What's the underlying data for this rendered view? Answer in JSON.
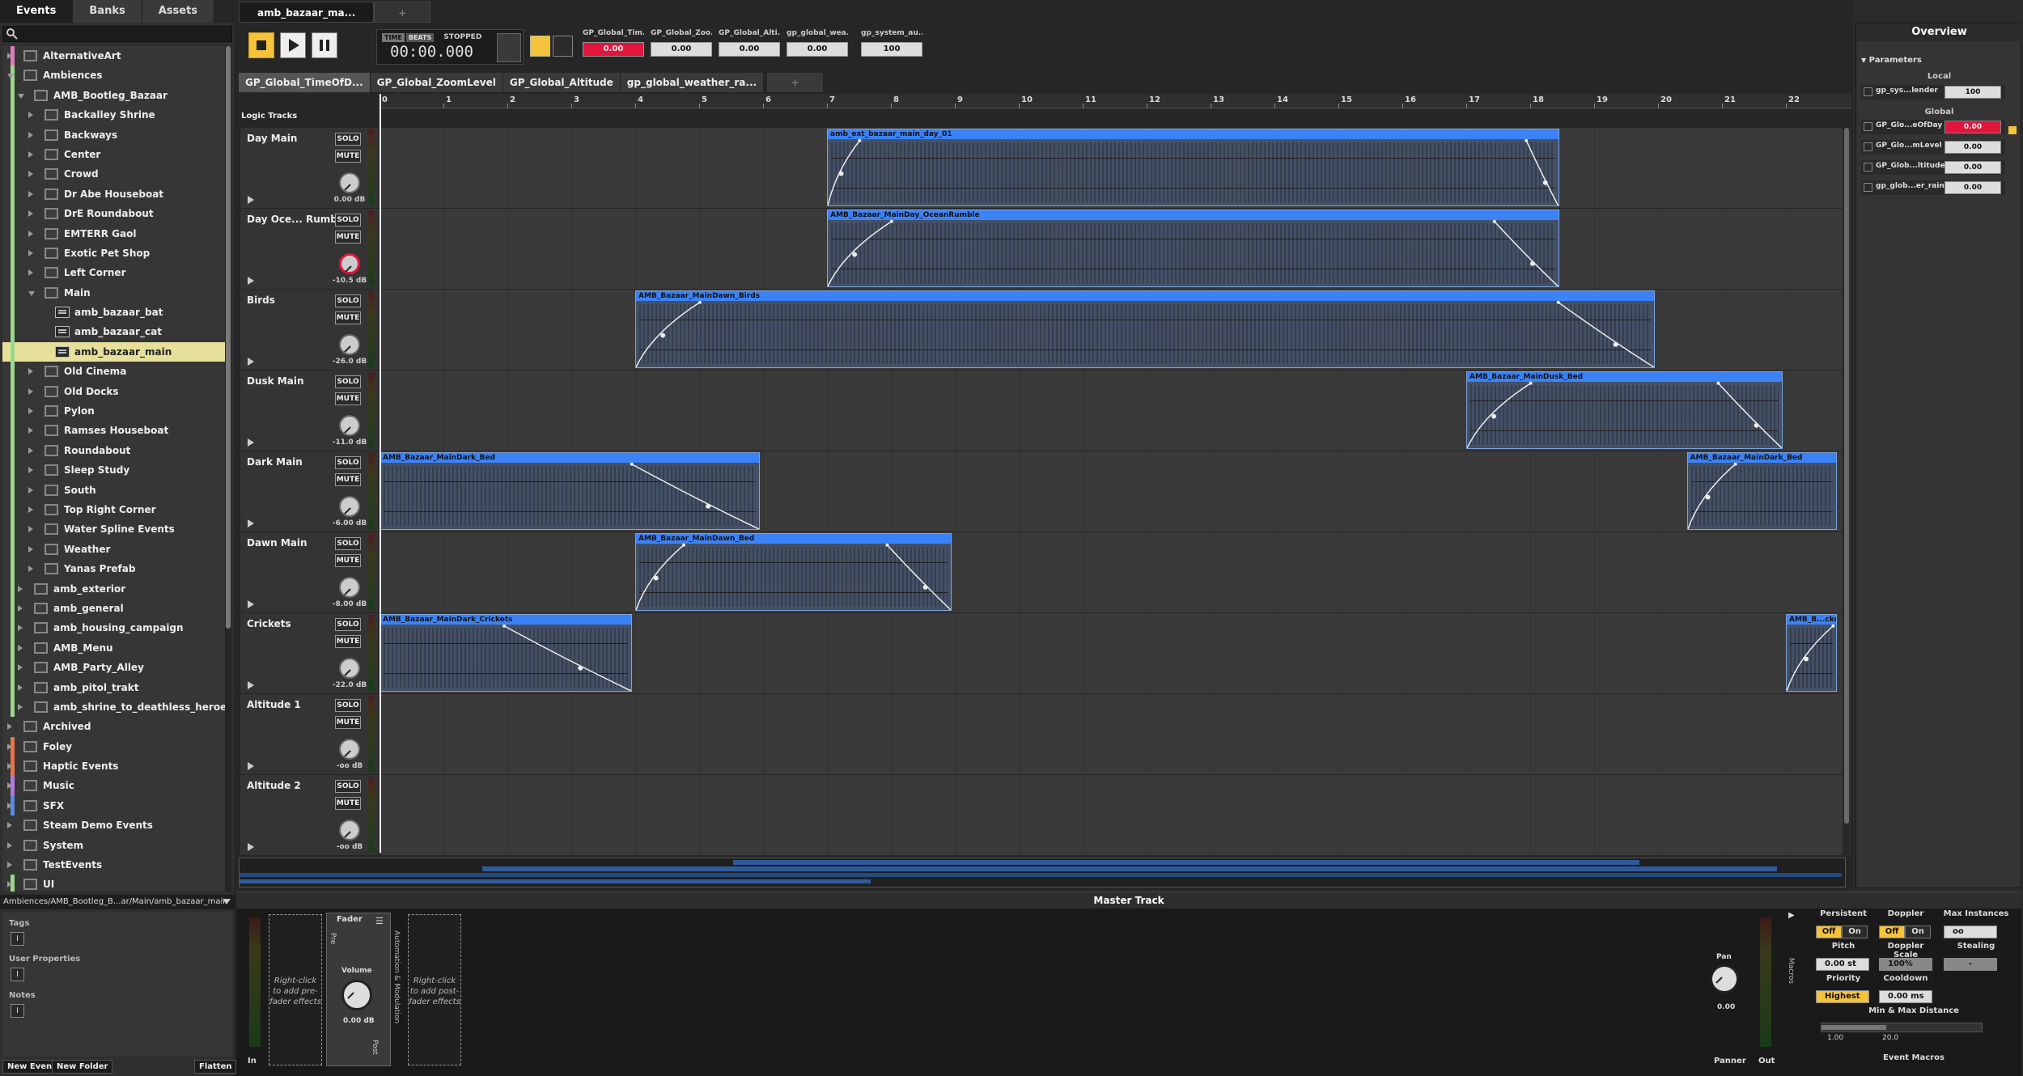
{
  "browser": {
    "tabs": [
      "Events",
      "Banks",
      "Assets"
    ],
    "tree": [
      {
        "label": "AlternativeArt",
        "indent": 0,
        "type": "folder",
        "open": false,
        "color": "#e07ab8"
      },
      {
        "label": "Ambiences",
        "indent": 0,
        "type": "folder",
        "open": true,
        "color": "#9ad88a"
      },
      {
        "label": "AMB_Bootleg_Bazaar",
        "indent": 1,
        "type": "folder",
        "open": true,
        "color": "#9ad88a"
      },
      {
        "label": "Backalley Shrine",
        "indent": 2,
        "type": "folder",
        "open": false,
        "color": "#9ad88a"
      },
      {
        "label": "Backways",
        "indent": 2,
        "type": "folder",
        "open": false,
        "color": "#9ad88a"
      },
      {
        "label": "Center",
        "indent": 2,
        "type": "folder",
        "open": false,
        "color": "#9ad88a"
      },
      {
        "label": "Crowd",
        "indent": 2,
        "type": "folder",
        "open": false,
        "color": "#9ad88a"
      },
      {
        "label": "Dr Abe Houseboat",
        "indent": 2,
        "type": "folder",
        "open": false,
        "color": "#9ad88a"
      },
      {
        "label": "DrE Roundabout",
        "indent": 2,
        "type": "folder",
        "open": false,
        "color": "#9ad88a"
      },
      {
        "label": "EMTERR Gaol",
        "indent": 2,
        "type": "folder",
        "open": false,
        "color": "#9ad88a"
      },
      {
        "label": "Exotic Pet Shop",
        "indent": 2,
        "type": "folder",
        "open": false,
        "color": "#9ad88a"
      },
      {
        "label": "Left Corner",
        "indent": 2,
        "type": "folder",
        "open": false,
        "color": "#9ad88a"
      },
      {
        "label": "Main",
        "indent": 2,
        "type": "folder",
        "open": true,
        "color": "#9ad88a"
      },
      {
        "label": "amb_bazaar_bat",
        "indent": 3,
        "type": "event",
        "color": "#9ad88a"
      },
      {
        "label": "amb_bazaar_cat",
        "indent": 3,
        "type": "event",
        "color": "#9ad88a"
      },
      {
        "label": "amb_bazaar_main",
        "indent": 3,
        "type": "event",
        "color": "#9ad88a",
        "selected": true
      },
      {
        "label": "Old Cinema",
        "indent": 2,
        "type": "folder",
        "open": false,
        "color": "#9ad88a"
      },
      {
        "label": "Old Docks",
        "indent": 2,
        "type": "folder",
        "open": false,
        "color": "#9ad88a"
      },
      {
        "label": "Pylon",
        "indent": 2,
        "type": "folder",
        "open": false,
        "color": "#9ad88a"
      },
      {
        "label": "Ramses Houseboat",
        "indent": 2,
        "type": "folder",
        "open": false,
        "color": "#9ad88a"
      },
      {
        "label": "Roundabout",
        "indent": 2,
        "type": "folder",
        "open": false,
        "color": "#9ad88a"
      },
      {
        "label": "Sleep Study",
        "indent": 2,
        "type": "folder",
        "open": false,
        "color": "#9ad88a"
      },
      {
        "label": "South",
        "indent": 2,
        "type": "folder",
        "open": false,
        "color": "#9ad88a"
      },
      {
        "label": "Top Right Corner",
        "indent": 2,
        "type": "folder",
        "open": false,
        "color": "#9ad88a"
      },
      {
        "label": "Water Spline Events",
        "indent": 2,
        "type": "folder",
        "open": false,
        "color": "#9ad88a"
      },
      {
        "label": "Weather",
        "indent": 2,
        "type": "folder",
        "open": false,
        "color": "#9ad88a"
      },
      {
        "label": "Yanas Prefab",
        "indent": 2,
        "type": "folder",
        "open": false,
        "color": "#9ad88a"
      },
      {
        "label": "amb_exterior",
        "indent": 1,
        "type": "folder",
        "open": false,
        "color": "#9ad88a"
      },
      {
        "label": "amb_general",
        "indent": 1,
        "type": "folder",
        "open": false,
        "color": "#9ad88a"
      },
      {
        "label": "amb_housing_campaign",
        "indent": 1,
        "type": "folder",
        "open": false,
        "color": "#9ad88a"
      },
      {
        "label": "AMB_Menu",
        "indent": 1,
        "type": "folder",
        "open": false,
        "color": "#9ad88a"
      },
      {
        "label": "AMB_Party_Alley",
        "indent": 1,
        "type": "folder",
        "open": false,
        "color": "#9ad88a"
      },
      {
        "label": "amb_pitol_trakt",
        "indent": 1,
        "type": "folder",
        "open": false,
        "color": "#9ad88a"
      },
      {
        "label": "amb_shrine_to_deathless_heroes",
        "indent": 1,
        "type": "folder",
        "open": false,
        "color": "#9ad88a"
      },
      {
        "label": "Archived",
        "indent": 0,
        "type": "folder",
        "open": false,
        "color": ""
      },
      {
        "label": "Foley",
        "indent": 0,
        "type": "folder",
        "open": false,
        "color": "#e8734a"
      },
      {
        "label": "Haptic Events",
        "indent": 0,
        "type": "folder",
        "open": false,
        "color": "#e8734a"
      },
      {
        "label": "Music",
        "indent": 0,
        "type": "folder",
        "open": false,
        "color": "#b07ad8"
      },
      {
        "label": "SFX",
        "indent": 0,
        "type": "folder",
        "open": false,
        "color": "#5a8ae0"
      },
      {
        "label": "Steam Demo Events",
        "indent": 0,
        "type": "folder",
        "open": false,
        "color": ""
      },
      {
        "label": "System",
        "indent": 0,
        "type": "folder",
        "open": false,
        "color": ""
      },
      {
        "label": "TestEvents",
        "indent": 0,
        "type": "folder",
        "open": false,
        "color": ""
      },
      {
        "label": "UI",
        "indent": 0,
        "type": "folder",
        "open": false,
        "color": "#9ad88a"
      }
    ],
    "path": "Ambiences/AMB_Bootleg_B...ar/Main/amb_bazaar_main",
    "props": {
      "tags": "Tags",
      "user_props": "User Properties",
      "notes": "Notes",
      "add_glyph": "I"
    },
    "buttons": {
      "new_event": "New Event",
      "new_folder": "New Folder",
      "flatten": "Flatten"
    }
  },
  "editor": {
    "tab": "amb_bazaar_ma...",
    "add_tab": "+",
    "time_mode": [
      "TIME",
      "BEATS"
    ],
    "state": "STOPPED",
    "time": "00:00.000",
    "params": [
      {
        "label": "GP_Global_Tim...",
        "value": "0.00",
        "red": true
      },
      {
        "label": "GP_Global_Zoo...",
        "value": "0.00",
        "red": false
      },
      {
        "label": "GP_Global_Alti...",
        "value": "0.00",
        "red": false
      },
      {
        "label": "gp_global_wea...",
        "value": "0.00",
        "red": false
      },
      {
        "label": "gp_system_au...",
        "value": "100",
        "red": false
      }
    ],
    "param_tabs": [
      "GP_Global_TimeOfD...",
      "GP_Global_ZoomLevel",
      "GP_Global_Altitude",
      "gp_global_weather_ra...",
      "+"
    ],
    "ruler": [
      "0",
      "1",
      "2",
      "3",
      "4",
      "5",
      "6",
      "7",
      "8",
      "9",
      "10",
      "11",
      "12",
      "13",
      "14",
      "15",
      "16",
      "17",
      "18",
      "19",
      "20",
      "21",
      "22"
    ],
    "logic_label": "Logic Tracks",
    "solo": "SOLO",
    "mute": "MUTE",
    "tracks": [
      {
        "name": "Day Main",
        "volume": "0.00 dB",
        "red_knob": false,
        "instruments": [
          {
            "title": "amb_ext_bazaar_main_day_01",
            "start": 7.0,
            "end": 18.45,
            "fade_in": 0.5,
            "fade_out": 0.5
          }
        ]
      },
      {
        "name": "Day Oce... Rumble",
        "volume": "-10.5 dB",
        "red_knob": true,
        "instruments": [
          {
            "title": "AMB_Bazaar_MainDay_OceanRumble",
            "start": 7.0,
            "end": 18.45,
            "fade_in": 1.0,
            "fade_out": 1.0
          }
        ]
      },
      {
        "name": "Birds",
        "volume": "-26.0 dB",
        "red_knob": false,
        "instruments": [
          {
            "title": "AMB_Bazaar_MainDawn_Birds",
            "start": 4.0,
            "end": 19.95,
            "fade_in": 1.0,
            "fade_out": 1.5
          }
        ]
      },
      {
        "name": "Dusk Main",
        "volume": "-11.0 dB",
        "red_knob": false,
        "instruments": [
          {
            "title": "AMB_Bazaar_MainDusk_Bed",
            "start": 17.0,
            "end": 21.95,
            "fade_in": 1.0,
            "fade_out": 1.0
          }
        ]
      },
      {
        "name": "Dark Main",
        "volume": "-6.00 dB",
        "red_knob": false,
        "instruments": [
          {
            "title": "AMB_Bazaar_MainDark_Bed",
            "start": 0.0,
            "end": 5.95,
            "fade_in": 0,
            "fade_out": 2.0
          },
          {
            "title": "AMB_Bazaar_MainDark_Bed",
            "start": 20.45,
            "end": 22.8,
            "fade_in": 0.75,
            "fade_out": 0
          }
        ]
      },
      {
        "name": "Dawn Main",
        "volume": "-8.00 dB",
        "red_knob": false,
        "instruments": [
          {
            "title": "AMB_Bazaar_MainDawn_Bed",
            "start": 4.0,
            "end": 8.95,
            "fade_in": 0.75,
            "fade_out": 1.0
          }
        ]
      },
      {
        "name": "Crickets",
        "volume": "-22.0 dB",
        "red_knob": false,
        "instruments": [
          {
            "title": "AMB_Bazaar_MainDark_Crickets",
            "start": 0.0,
            "end": 3.95,
            "fade_in": 0,
            "fade_out": 2.0
          },
          {
            "title": "AMB_B...ckets",
            "start": 22.0,
            "end": 22.8,
            "fade_in": 0.75,
            "fade_out": 0
          }
        ]
      },
      {
        "name": "Altitude 1",
        "volume": "-oo dB",
        "red_knob": false,
        "instruments": []
      },
      {
        "name": "Altitude 2",
        "volume": "-oo dB",
        "red_knob": false,
        "instruments": []
      }
    ]
  },
  "overview": {
    "title": "Overview",
    "section": "Parameters",
    "local_label": "Local",
    "global_label": "Global",
    "local": [
      {
        "name": "gp_sys...lender",
        "value": "100",
        "red": false
      }
    ],
    "global": [
      {
        "name": "GP_Glo...eOfDay",
        "value": "0.00",
        "red": true
      },
      {
        "name": "GP_Glo...mLevel",
        "value": "0.00",
        "red": false
      },
      {
        "name": "GP_Glob...ltitude",
        "value": "0.00",
        "red": false
      },
      {
        "name": "gp_glob...er_rain",
        "value": "0.00",
        "red": false
      }
    ]
  },
  "master": {
    "title": "Master Track",
    "in": "In",
    "out": "Out",
    "pre_effects": "Right-click to add pre-fader effects",
    "post_effects": "Right-click to add post-fader effects",
    "fader_label": "Fader",
    "pre": "Pre",
    "post": "Post",
    "volume_label": "Volume",
    "volume": "0.00 dB",
    "automation": "Automation & Modulation",
    "pan_label": "Pan",
    "pan": "0.00",
    "panner": "Panner",
    "macros_label": "Macros",
    "event_macros": "Event Macros",
    "persistent": "Persistent",
    "doppler": "Doppler",
    "max_instances": "Max Instances",
    "off": "Off",
    "on": "On",
    "max_instances_value": "oo",
    "pitch": "Pitch",
    "pitch_value": "0.00 st",
    "doppler_scale": "Doppler Scale",
    "doppler_scale_value": "100%",
    "stealing": "Stealing",
    "stealing_value": "-",
    "priority": "Priority",
    "priority_value": "Highest",
    "cooldown": "Cooldown",
    "cooldown_value": "0.00 ms",
    "min_max": "Min & Max Distance",
    "min_value": "1.00",
    "max_value": "20.0"
  },
  "colors": {
    "accent_blue": "#3b82f6",
    "param_red": "#e2163d",
    "selection": "#e6e09a",
    "toggle_on": "#f4c33b"
  }
}
